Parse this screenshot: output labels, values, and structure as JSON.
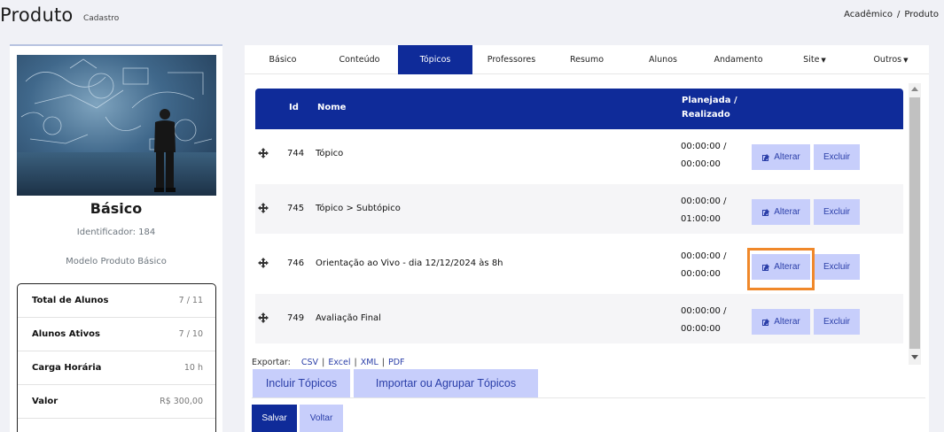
{
  "header": {
    "title": "Produto",
    "subtitle": "Cadastro"
  },
  "breadcrumb": {
    "items": [
      "Acadêmico",
      "Produto"
    ],
    "separator": "/"
  },
  "product_card": {
    "title": "Básico",
    "identifier": "Identificador: 184",
    "model": "Modelo Produto Básico",
    "stats": [
      {
        "label": "Total de Alunos",
        "value": "7 / 11"
      },
      {
        "label": "Alunos Ativos",
        "value": "7 / 10"
      },
      {
        "label": "Carga Horária",
        "value": "10 h"
      },
      {
        "label": "Valor",
        "value": "R$ 300,00"
      }
    ]
  },
  "tabs": [
    {
      "label": "Básico"
    },
    {
      "label": "Conteúdo"
    },
    {
      "label": "Tópicos"
    },
    {
      "label": "Professores"
    },
    {
      "label": "Resumo"
    },
    {
      "label": "Alunos"
    },
    {
      "label": "Andamento"
    },
    {
      "label": "Site"
    },
    {
      "label": "Outros"
    }
  ],
  "active_tab": "Tópicos",
  "table": {
    "headers": {
      "id": "Id",
      "name": "Nome",
      "time_line1": "Planejada /",
      "time_line2": "Realizado"
    },
    "rows": [
      {
        "id": "744",
        "name": "Tópico",
        "planned": "00:00:00 /",
        "done": "00:00:00"
      },
      {
        "id": "745",
        "name": "Tópico > Subtópico",
        "planned": "00:00:00 /",
        "done": "01:00:00"
      },
      {
        "id": "746",
        "name": "Orientação ao Vivo - dia 12/12/2024 às 8h",
        "planned": "00:00:00 /",
        "done": "00:00:00"
      },
      {
        "id": "749",
        "name": "Avaliação Final",
        "planned": "00:00:00 /",
        "done": "00:00:00"
      }
    ],
    "edit_label": "Alterar",
    "delete_label": "Excluir"
  },
  "export": {
    "label": "Exportar:",
    "csv": "CSV",
    "excel": "Excel",
    "xml": "XML",
    "pdf": "PDF"
  },
  "actions": {
    "include_topics": "Incluir Tópicos",
    "import_topics": "Importar ou Agrupar Tópicos",
    "save": "Salvar",
    "back": "Voltar"
  },
  "colors": {
    "primary": "#0f2b99",
    "button_light": "#c7cefb",
    "highlight": "#f0882a"
  }
}
